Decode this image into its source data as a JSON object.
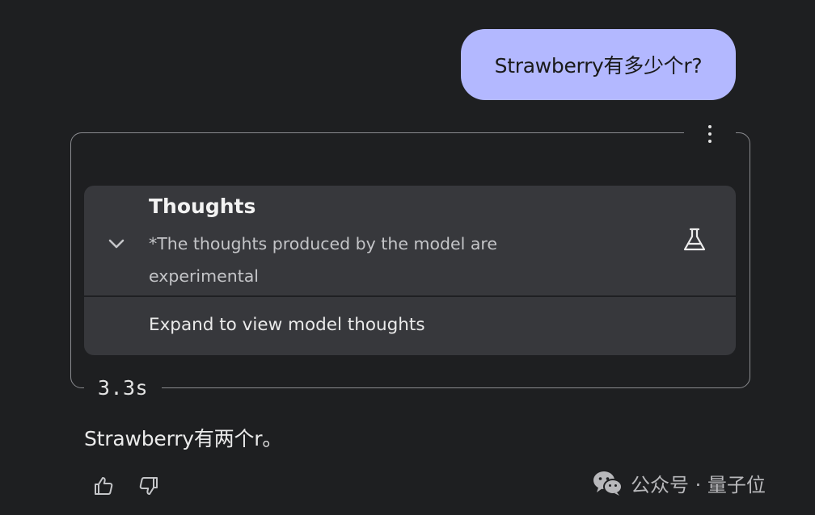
{
  "user_message": {
    "text": "Strawberry有多少个r?"
  },
  "thoughts": {
    "title": "Thoughts",
    "subtitle": "*The thoughts produced by the model are experimental",
    "expand_label": "Expand to view model thoughts",
    "chevron_icon": "chevron-down-icon",
    "experimental_icon": "flask-icon"
  },
  "response": {
    "elapsed": "3.3s",
    "answer": "Strawberry有两个r。",
    "menu_icon": "more-vert-icon"
  },
  "feedback": {
    "like_icon": "thumbs-up-icon",
    "dislike_icon": "thumbs-down-icon"
  },
  "watermark": {
    "text": "公众号 · 量子位",
    "icon": "wechat-icon"
  },
  "colors": {
    "background": "#1e1f21",
    "user_bubble": "#b3b8ff",
    "card": "#37383c",
    "text": "#e3e3e3"
  }
}
